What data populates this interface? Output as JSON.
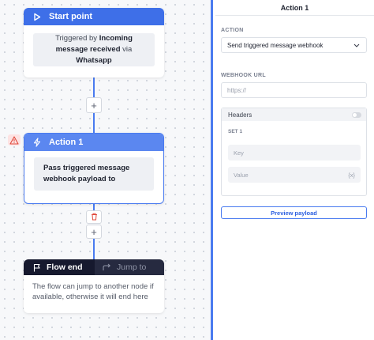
{
  "canvas": {
    "start_node": {
      "title": "Start point",
      "message_prefix": "Triggered by",
      "message_bold1": "Incoming message received",
      "message_mid": "via",
      "message_bold2": "Whatsapp"
    },
    "action_node": {
      "title": "Action 1",
      "message": "Pass triggered message webhook payload to"
    },
    "flow_end_node": {
      "tab_active": "Flow end",
      "tab_inactive": "Jump to",
      "text": "The flow can jump to another node if available, otherwise it will end here"
    },
    "add_symbol": "+"
  },
  "panel": {
    "title": "Action 1",
    "action_label": "ACTION",
    "action_value": "Send triggered message webhook",
    "webhook_label": "WEBHOOK URL",
    "webhook_placeholder": "https://",
    "headers_title": "Headers",
    "set_label": "SET 1",
    "key_placeholder": "Key",
    "value_placeholder": "Value",
    "value_suffix": "{x}",
    "preview_button": "Preview payload"
  },
  "colors": {
    "accent": "#3e6fe8",
    "warning": "#e0483b",
    "dark_node": "#16192e"
  }
}
